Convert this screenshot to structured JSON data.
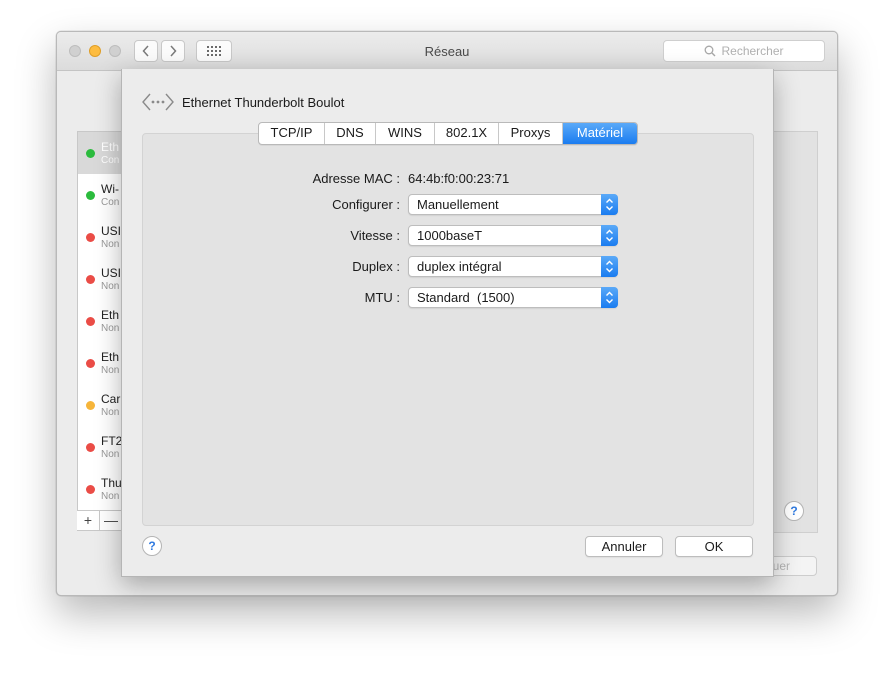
{
  "window": {
    "title": "Réseau",
    "search_placeholder": "Rechercher",
    "apply_label": "quer"
  },
  "services": [
    {
      "name": "Eth",
      "status": "Con",
      "color": "#2bbb3d"
    },
    {
      "name": "Wi-",
      "status": "Con",
      "color": "#2bbb3d"
    },
    {
      "name": "USI",
      "status": "Non",
      "color": "#ea4c46"
    },
    {
      "name": "USI",
      "status": "Non",
      "color": "#ea4c46"
    },
    {
      "name": "Eth",
      "status": "Non",
      "color": "#ea4c46"
    },
    {
      "name": "Eth",
      "status": "Non",
      "color": "#ea4c46"
    },
    {
      "name": "Car",
      "status": "Non",
      "color": "#f6b53a"
    },
    {
      "name": "FT2",
      "status": "Non",
      "color": "#ea4c46"
    },
    {
      "name": "Thu",
      "status": "Non",
      "color": "#ea4c46"
    }
  ],
  "list_controls": {
    "add": "+",
    "remove": "—"
  },
  "help_glyph": "?",
  "sheet": {
    "title": "Ethernet Thunderbolt Boulot",
    "tabs": [
      "TCP/IP",
      "DNS",
      "WINS",
      "802.1X",
      "Proxys",
      "Matériel"
    ],
    "active_tab": "Matériel",
    "fields": {
      "mac_label": "Adresse MAC :",
      "mac_value": "64:4b:f0:00:23:71",
      "configure_label": "Configurer :",
      "configure_value": "Manuellement",
      "speed_label": "Vitesse :",
      "speed_value": "1000baseT",
      "duplex_label": "Duplex :",
      "duplex_value": "duplex intégral",
      "mtu_label": "MTU :",
      "mtu_value": "Standard  (1500)"
    },
    "cancel_label": "Annuler",
    "ok_label": "OK"
  },
  "colors": {
    "accent": "#1a7cf0",
    "help": "#2f7ae0"
  }
}
